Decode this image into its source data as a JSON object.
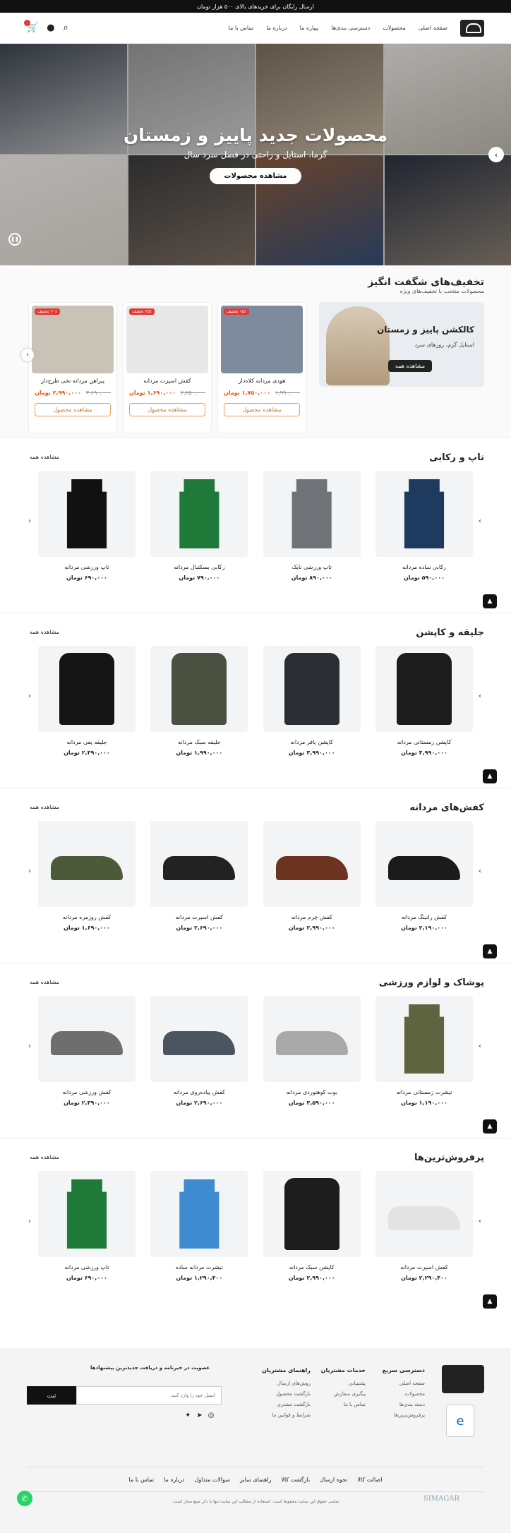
{
  "topbar": {
    "text": "ارسال رایگان برای خریدهای بالای ۵۰۰ هزار تومان"
  },
  "header": {
    "nav": [
      "صفحه اصلی",
      "محصولات",
      "دسترسی بندی‌ها",
      "پیپاره ما",
      "درباره ما",
      "تماس با ما"
    ],
    "cart_count": "۰"
  },
  "hero": {
    "title": "محصولات جدید پاییز و زمستان",
    "subtitle": "گرما، استایل و راحتی در فصل سرد سال",
    "button": "مشاهده محصولات"
  },
  "deals": {
    "title": "تخفیف‌های شگفت انگیز",
    "subtitle": "محصولات منتخب با تخفیف‌های ویژه",
    "promo": {
      "title": "کالکشن پاییز و زمستان",
      "subtitle": "استایل گرم، روزهای سرد",
      "button": "مشاهده همه"
    },
    "items": [
      {
        "name": "هودی مردانه کلاه‌دار",
        "old": "۱,۹۹۰,۰۰۰",
        "new": "۱,۷۵۰,۰۰۰ تومان",
        "off": "۱۵٪ تخفیف",
        "button": "مشاهده محصول",
        "color": "#7d8b9c"
      },
      {
        "name": "کفش اسپرت مردانه",
        "old": "۲,۲۵۰,۰۰۰",
        "new": "۱,۶۹۰,۰۰۰ تومان",
        "off": "۲۵٪ تخفیف",
        "button": "مشاهده محصول",
        "color": "#e8e8e8"
      },
      {
        "name": "پیراهن مردانه نخی طرح‌دار",
        "old": "۳,۶۹۰,۰۰۰",
        "new": "۲,۹۹۰,۰۰۰ تومان",
        "off": "۲۰٪ تخفیف",
        "button": "مشاهده محصول",
        "color": "#c8c3b6"
      }
    ]
  },
  "sections": [
    {
      "title": "تاپ و رکابی",
      "see_all": "مشاهده همه",
      "items": [
        {
          "name": "رکابی ساده مردانه",
          "price": "۵۹۰,۰۰۰ تومان",
          "color": "#1e3a5f",
          "shape": "shirt"
        },
        {
          "name": "تاپ ورزشی نایک",
          "price": "۸۹۰,۰۰۰ تومان",
          "color": "#6f7378",
          "shape": "shirt"
        },
        {
          "name": "رکابی بسکتبال مردانه",
          "price": "۷۹۰,۰۰۰ تومان",
          "color": "#1f7a3a",
          "shape": "shirt"
        },
        {
          "name": "تاپ ورزشی مردانه",
          "price": "۶۹۰,۰۰۰ تومان",
          "color": "#111111",
          "shape": "shirt"
        }
      ]
    },
    {
      "title": "جلیقه و کاپشن",
      "see_all": "مشاهده همه",
      "items": [
        {
          "name": "کاپشن زمستانی مردانه",
          "price": "۴,۹۹۰,۰۰۰ تومان",
          "color": "#1c1c1c",
          "shape": "jacket"
        },
        {
          "name": "کاپشن پافر مردانه",
          "price": "۳,۹۹۰,۰۰۰ تومان",
          "color": "#2b2e33",
          "shape": "jacket"
        },
        {
          "name": "جلیقه سبک مردانه",
          "price": "۱,۹۹۰,۰۰۰ تومان",
          "color": "#4b5140",
          "shape": "jacket"
        },
        {
          "name": "جلیقه پفی مردانه",
          "price": "۲,۴۹۰,۰۰۰ تومان",
          "color": "#151515",
          "shape": "jacket"
        }
      ]
    },
    {
      "title": "کفش‌های مردانه",
      "see_all": "مشاهده همه",
      "items": [
        {
          "name": "کفش رانینگ مردانه",
          "price": "۲,۱۹۰,۰۰۰ تومان",
          "color": "#1b1b1b",
          "shape": "shoe"
        },
        {
          "name": "کفش چرم مردانه",
          "price": "۲,۹۹۰,۰۰۰ تومان",
          "color": "#6b3320",
          "shape": "shoe"
        },
        {
          "name": "کفش اسپرت مردانه",
          "price": "۲,۶۹۰,۰۰۰ تومان",
          "color": "#222222",
          "shape": "shoe"
        },
        {
          "name": "کفش روزمره مردانه",
          "price": "۱,۶۹۰,۰۰۰ تومان",
          "color": "#4d5a3a",
          "shape": "shoe"
        }
      ]
    },
    {
      "title": "پوشاک و لوازم ورزشی",
      "see_all": "مشاهده همه",
      "items": [
        {
          "name": "تیشرت زمستانی مردانه",
          "price": "۱,۱۹۰,۰۰۰ تومان",
          "color": "#5e6440",
          "shape": "shirt"
        },
        {
          "name": "بوت کوهنوردی مردانه",
          "price": "۳,۵۹۰,۰۰۰ تومان",
          "color": "#a9a9a9",
          "shape": "shoe"
        },
        {
          "name": "کفش پیاده‌روی مردانه",
          "price": "۲,۶۹۰,۰۰۰ تومان",
          "color": "#4a5560",
          "shape": "shoe"
        },
        {
          "name": "کفش ورزشی مردانه",
          "price": "۲,۳۹۰,۰۰۰ تومان",
          "color": "#6e6e6e",
          "shape": "shoe"
        }
      ]
    },
    {
      "title": "پرفروش‌ترین‌ها",
      "see_all": "مشاهده همه",
      "items": [
        {
          "name": "کفش اسپرت مردانه",
          "price": "۲,۲۹۰,۴۰۰ تومان",
          "color": "#e3e3e3",
          "shape": "shoe"
        },
        {
          "name": "کاپشن سبک مردانه",
          "price": "۲,۹۹۰,۰۰۰ تومان",
          "color": "#1d1d1d",
          "shape": "jacket"
        },
        {
          "name": "تیشرت مردانه ساده",
          "price": "۱,۲۹۰,۴۰۰ تومان",
          "color": "#3f8bd1",
          "shape": "shirt"
        },
        {
          "name": "تاپ ورزشی مردانه",
          "price": "۶۹۰,۰۰۰ تومان",
          "color": "#1f7a3a",
          "shape": "shirt"
        }
      ]
    }
  ],
  "footer": {
    "col1": {
      "title": "دسترسی سریع",
      "items": [
        "صفحه اصلی",
        "محصولات",
        "دسته بندی‌ها",
        "پرفروش‌ترین‌ها"
      ]
    },
    "col2": {
      "title": "خدمات مشتریان",
      "items": [
        "پشتیبانی",
        "پیگیری سفارش",
        "تماس با ما"
      ]
    },
    "col3": {
      "title": "راهنمای مشتریان",
      "items": [
        "روش‌های ارسال",
        "بازگشت محصول",
        "بازگشت مشتری",
        "شرایط و قوانین ما"
      ]
    },
    "newsletter": {
      "title": "عضویت در خبرنامه و دریافت جدیدترین پیشنهادها",
      "placeholder": "ایمیل خود را وارد کنید",
      "button": "ثبت"
    },
    "links": [
      "اصالت کالا",
      "نحوه ارسال",
      "بازگشت کالا",
      "راهنمای سایز",
      "سوالات متداول",
      "درباره ما",
      "تماس با ما"
    ],
    "copyright": "تمامی حقوق این سایت محفوظ است. استفاده از مطالب این سایت تنها با ذکر منبع مجاز است."
  },
  "watermark": "SIMAGAR"
}
